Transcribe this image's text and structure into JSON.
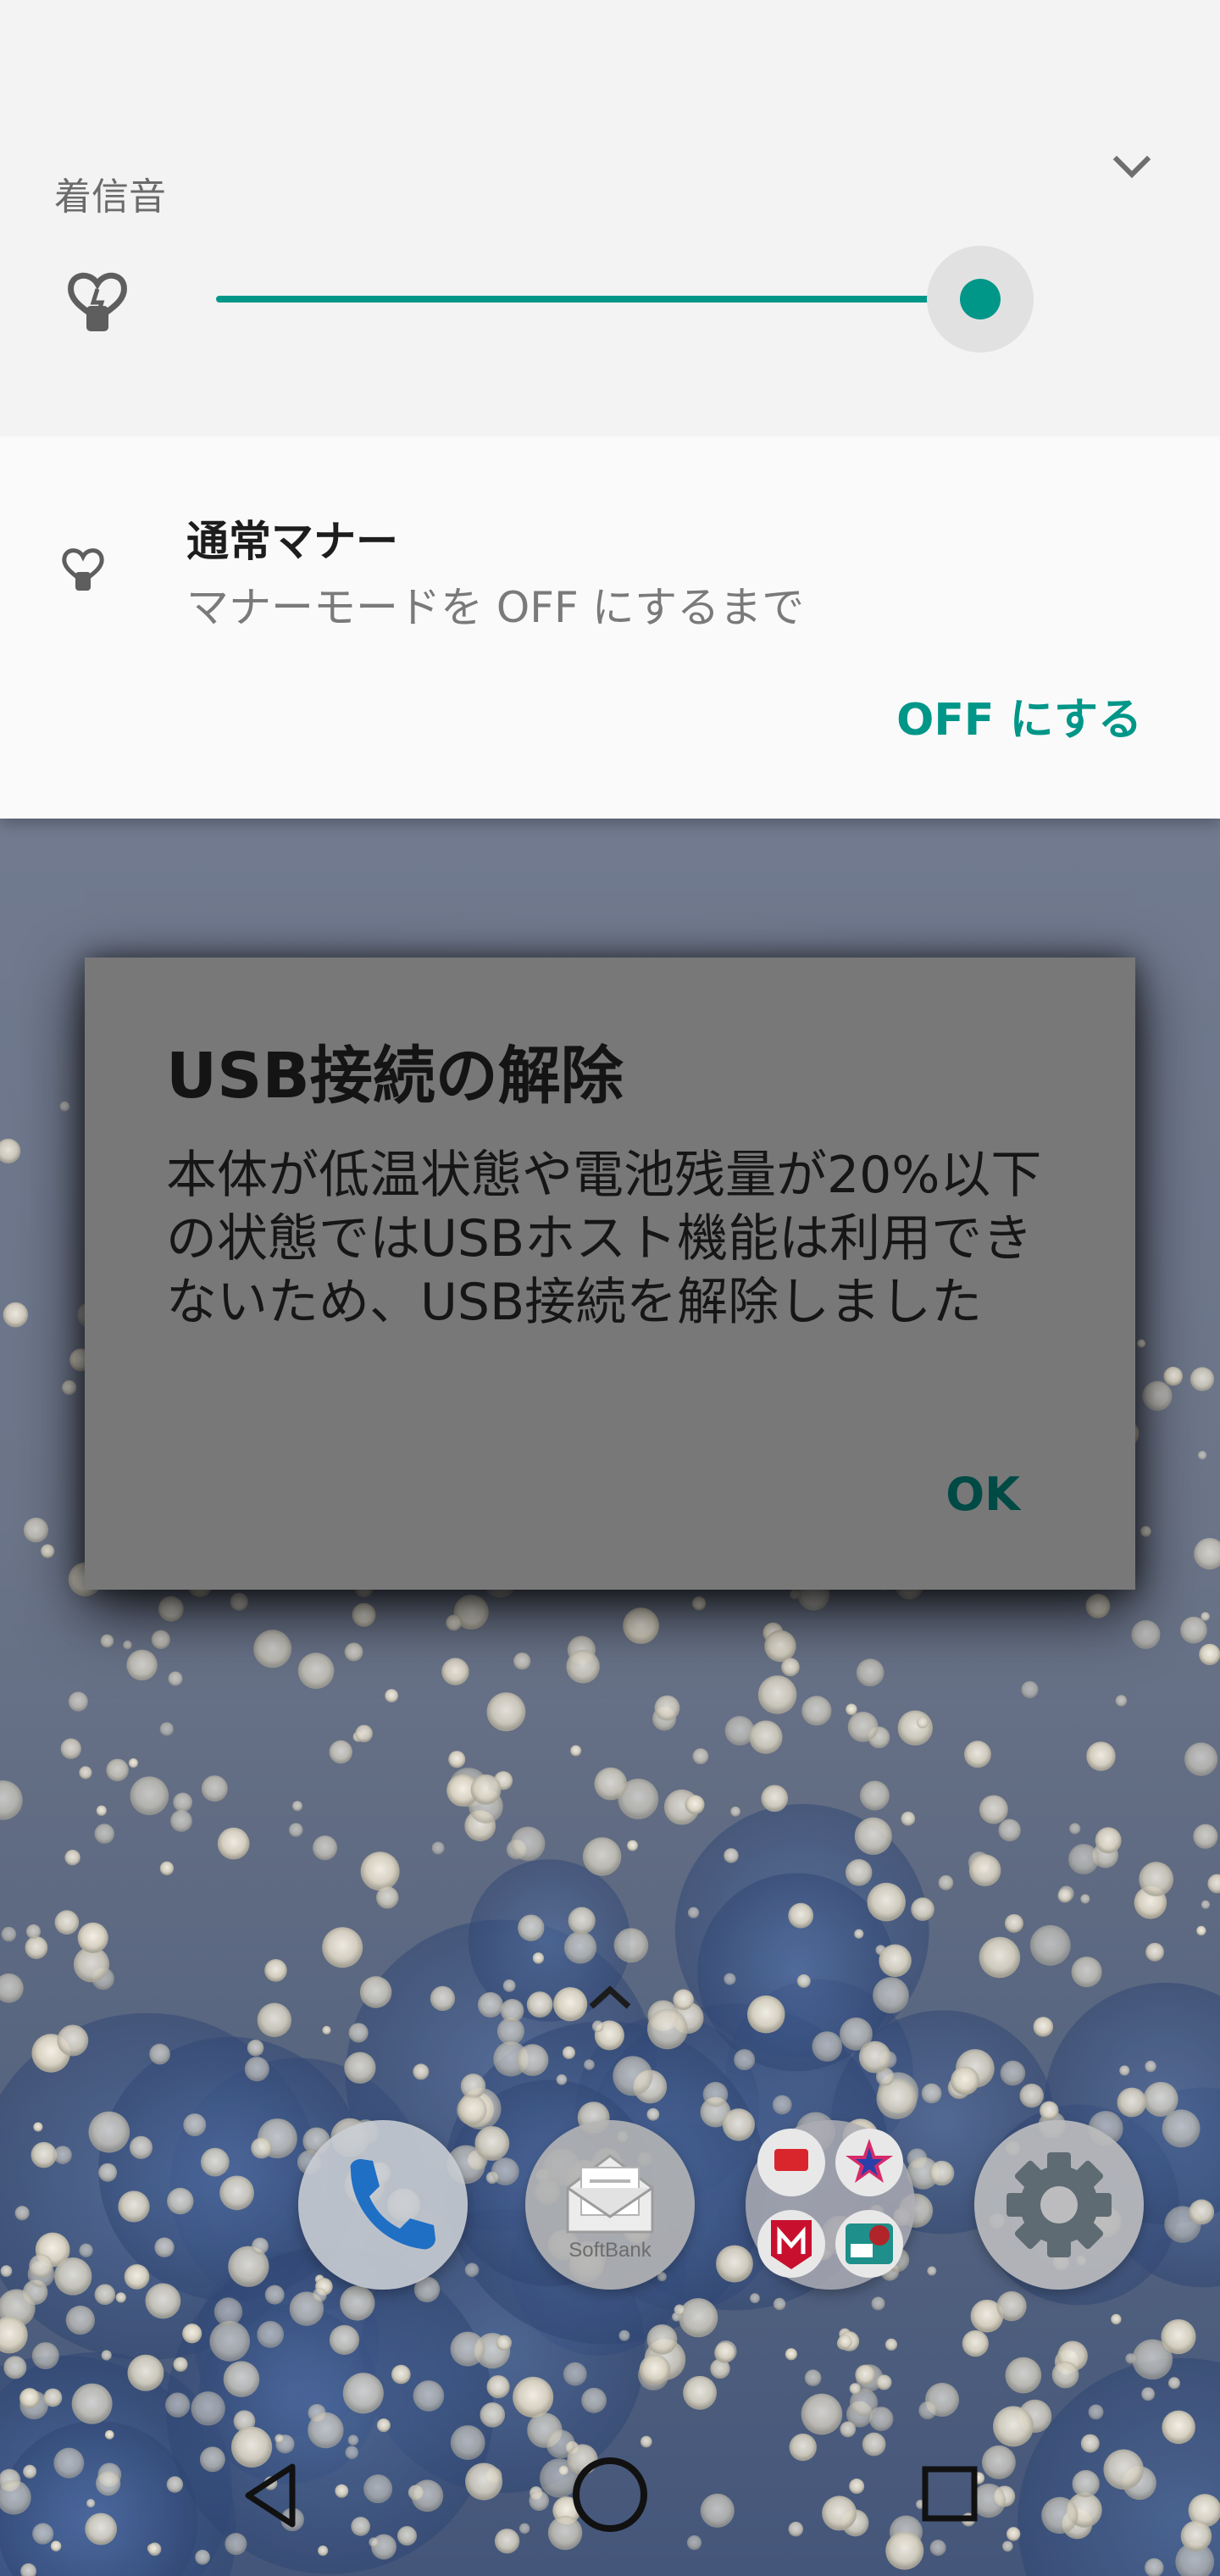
{
  "volume_panel": {
    "ringtone_label": "着信音",
    "ringtone_volume_fraction": 0.97,
    "dnd_title": "通常マナー",
    "dnd_subtitle": "マナーモードを OFF にするまで",
    "dnd_off_button": "OFF にする",
    "accent_color": "#009688"
  },
  "dialog": {
    "title": "USB接続の解除",
    "message": "本体が低温状態や電池残量が20%以下の状態ではUSBホスト機能は利用できないため、USB接続を解除しました",
    "ok_label": "OK"
  },
  "dock": {
    "apps": [
      {
        "name": "phone",
        "icon": "phone-icon"
      },
      {
        "name": "mail",
        "icon": "mail-icon",
        "label": "SoftBank"
      },
      {
        "name": "folder",
        "icon": "app-folder-icon"
      },
      {
        "name": "settings",
        "icon": "gear-icon"
      }
    ]
  },
  "navigation": {
    "buttons": [
      "back-icon",
      "home-icon",
      "recents-icon"
    ]
  }
}
